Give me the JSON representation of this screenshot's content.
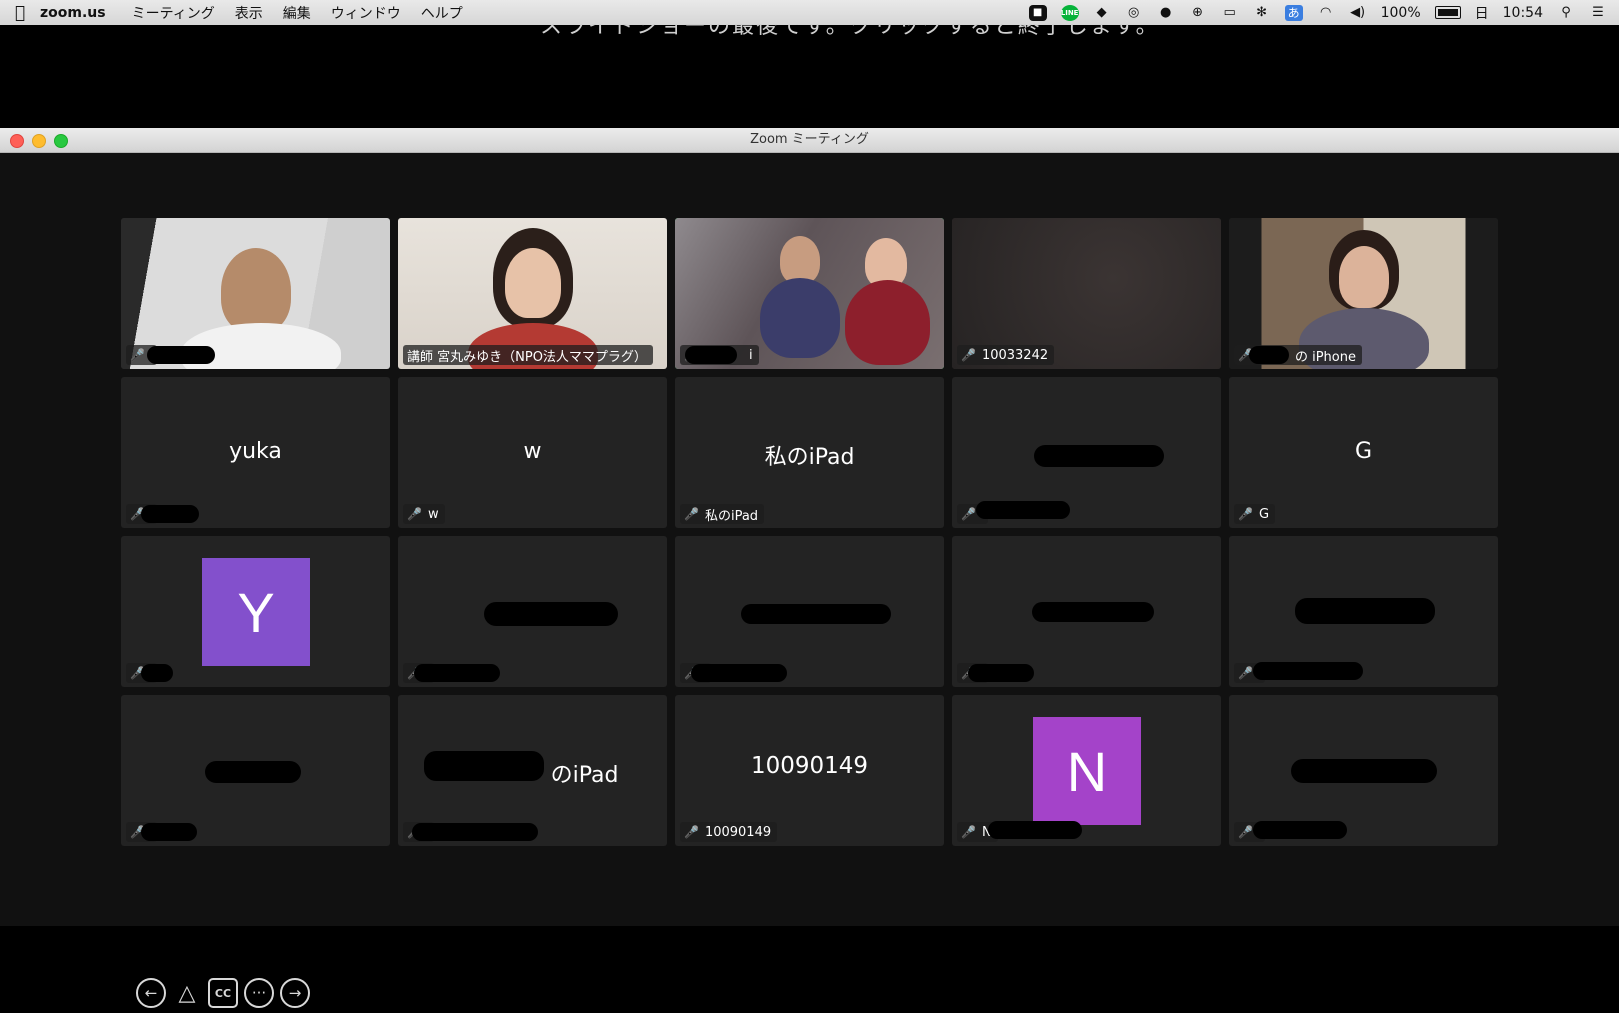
{
  "menubar": {
    "app_name": "zoom.us",
    "menus": [
      "ミーティング",
      "表示",
      "編集",
      "ウィンドウ",
      "ヘルプ"
    ],
    "battery": "100%",
    "day": "日",
    "time": "10:54",
    "ime_label": "あ",
    "line_label": "LINE"
  },
  "background_caption": "スライドショーの最後です。クリックすると終了します。",
  "window": {
    "title": "Zoom ミーティング"
  },
  "tiles": [
    {
      "center": "",
      "label": ""
    },
    {
      "center": "",
      "label": "講師 宮丸みゆき（NPO法人ママプラグ）"
    },
    {
      "center": "",
      "label": "i"
    },
    {
      "center": "",
      "label": "10033242"
    },
    {
      "center": "",
      "label": "の iPhone"
    },
    {
      "center": "yuka",
      "label": ""
    },
    {
      "center": "w",
      "label": "w"
    },
    {
      "center": "私のiPad",
      "label": "私のiPad"
    },
    {
      "center": "",
      "label": ""
    },
    {
      "center": "G",
      "label": "G"
    },
    {
      "center": "",
      "label": "",
      "avatar": "Y"
    },
    {
      "center": "",
      "label": ""
    },
    {
      "center": "",
      "label": ""
    },
    {
      "center": "",
      "label": ""
    },
    {
      "center": "",
      "label": ""
    },
    {
      "center": "",
      "label": ""
    },
    {
      "center": "のiPad",
      "label": ""
    },
    {
      "center": "10090149",
      "label": "10090149"
    },
    {
      "center": "",
      "label": "N",
      "avatar": "N"
    },
    {
      "center": "",
      "label": ""
    }
  ],
  "colors": {
    "active_speaker_border": "#23d160",
    "avatar_y": "#8350cc",
    "avatar_n": "#a443c9",
    "muted_mic": "#ff3b30"
  },
  "controls": {
    "cc_label": "CC",
    "more_label": "···"
  }
}
